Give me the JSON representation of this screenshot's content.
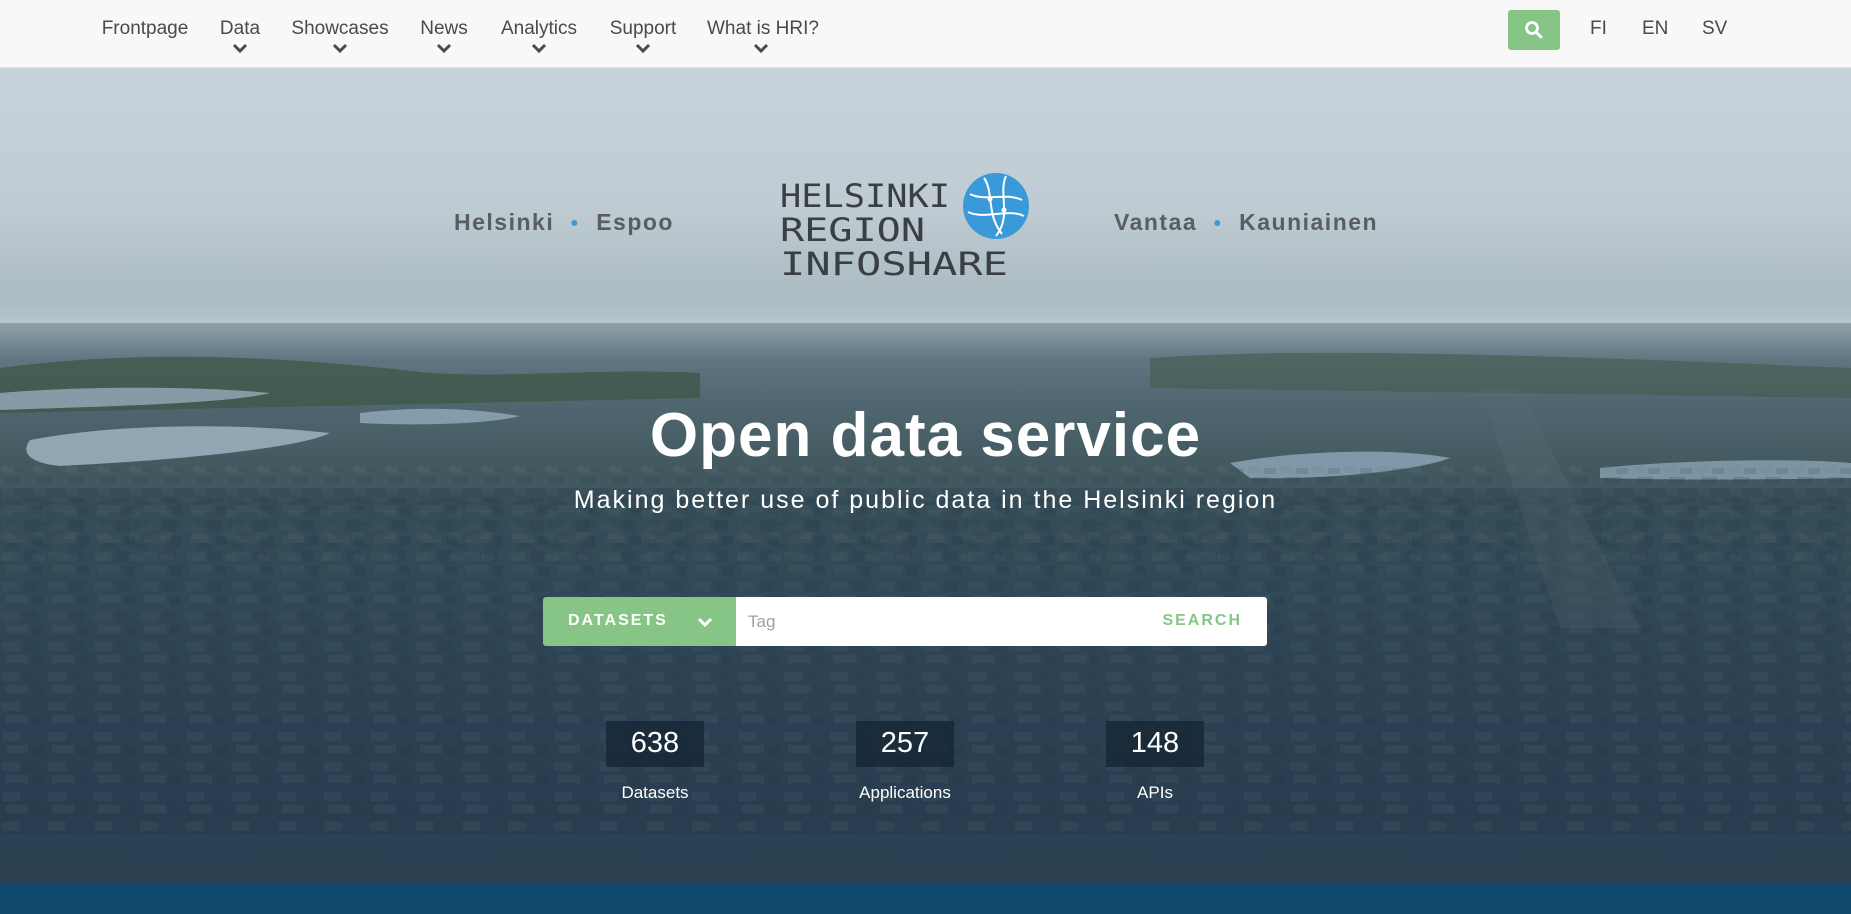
{
  "nav": {
    "items": [
      {
        "label": "Frontpage",
        "dropdown": false
      },
      {
        "label": "Data",
        "dropdown": true
      },
      {
        "label": "Showcases",
        "dropdown": true
      },
      {
        "label": "News",
        "dropdown": true
      },
      {
        "label": "Analytics",
        "dropdown": true
      },
      {
        "label": "Support",
        "dropdown": true
      },
      {
        "label": "What is HRI?",
        "dropdown": true
      }
    ],
    "search_icon": "search-icon",
    "languages": [
      "FI",
      "EN",
      "SV"
    ]
  },
  "hero": {
    "cities_left": [
      "Helsinki",
      "Espoo"
    ],
    "cities_right": [
      "Vantaa",
      "Kauniainen"
    ],
    "logo": {
      "line1": "HELSINKI",
      "line2": "REGION",
      "line3": "INFOSHARE"
    },
    "title": "Open data service",
    "subtitle": "Making better use of public data in the Helsinki region"
  },
  "search": {
    "category_label": "DATASETS",
    "placeholder": "Tag",
    "value": "",
    "submit_label": "SEARCH"
  },
  "stats": [
    {
      "value": "638",
      "label": "Datasets"
    },
    {
      "value": "257",
      "label": "Applications"
    },
    {
      "value": "148",
      "label": "APIs"
    }
  ],
  "colors": {
    "accent_green": "#86c585",
    "logo_blue": "#3a9ad9",
    "footer_blue": "#0f4a6e"
  }
}
